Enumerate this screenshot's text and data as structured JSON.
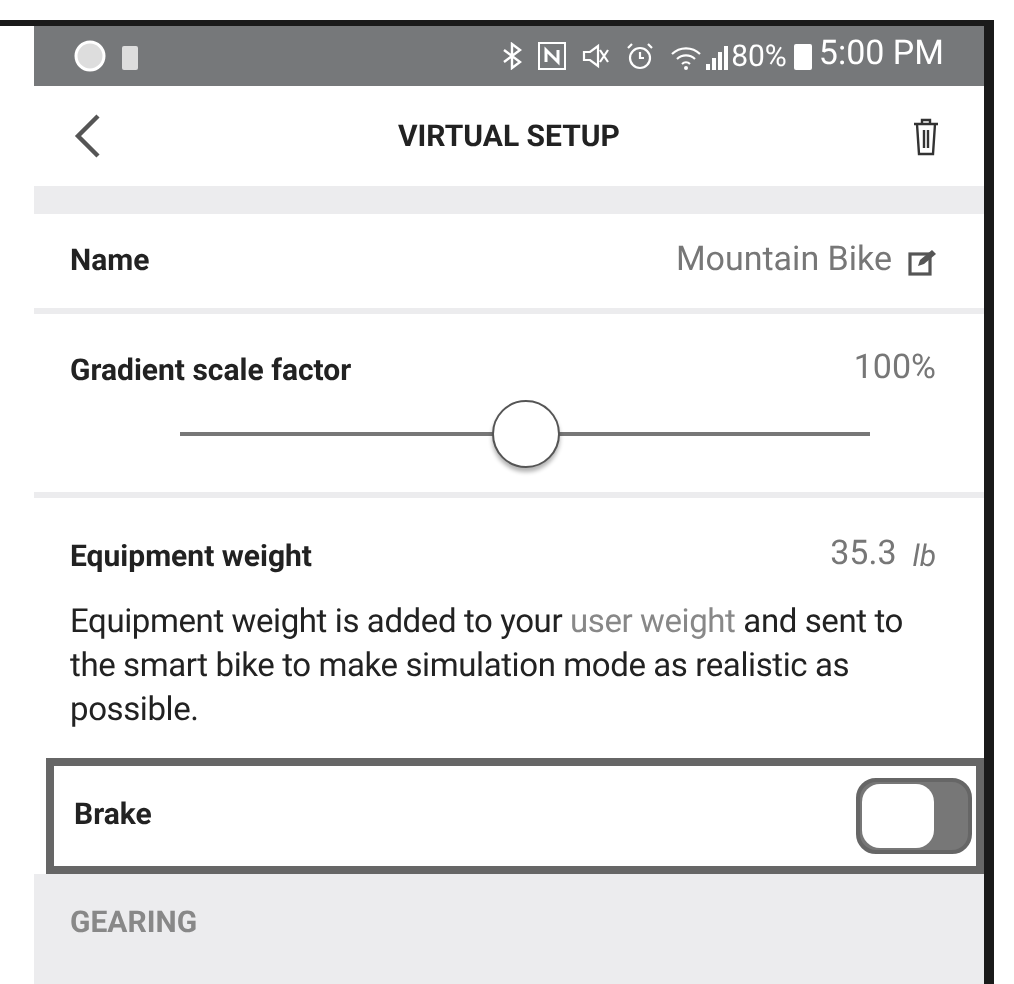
{
  "status_bar": {
    "battery_percent": "80%",
    "time": "5:00 PM"
  },
  "header": {
    "title": "VIRTUAL SETUP"
  },
  "name_row": {
    "label": "Name",
    "value": "Mountain Bike"
  },
  "gradient": {
    "label": "Gradient scale factor",
    "reading": "100%",
    "level": 0.5
  },
  "equipment_weight": {
    "label": "Equipment weight",
    "value": "35.3",
    "unit": "lb",
    "description_before": "Equipment weight is added to your",
    "description_link": "user weight",
    "description_after": "and sent to the smart bike to make simulation mode as realistic as possible."
  },
  "brake": {
    "label": "Brake",
    "on": false,
    "highlighted": true
  },
  "section": {
    "title": "GEARING"
  }
}
